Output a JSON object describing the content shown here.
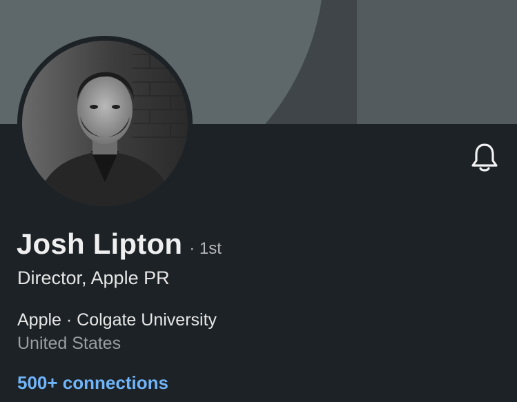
{
  "profile": {
    "name": "Josh Lipton",
    "degree": "· 1st",
    "headline": "Director, Apple PR",
    "org": "Apple · Colgate University",
    "location": "United States",
    "connections": "500+ connections"
  },
  "icons": {
    "notify": "bell-icon"
  },
  "colors": {
    "background": "#1d2226",
    "link": "#70b5f9",
    "secondary_text": "#9a9fa3"
  }
}
